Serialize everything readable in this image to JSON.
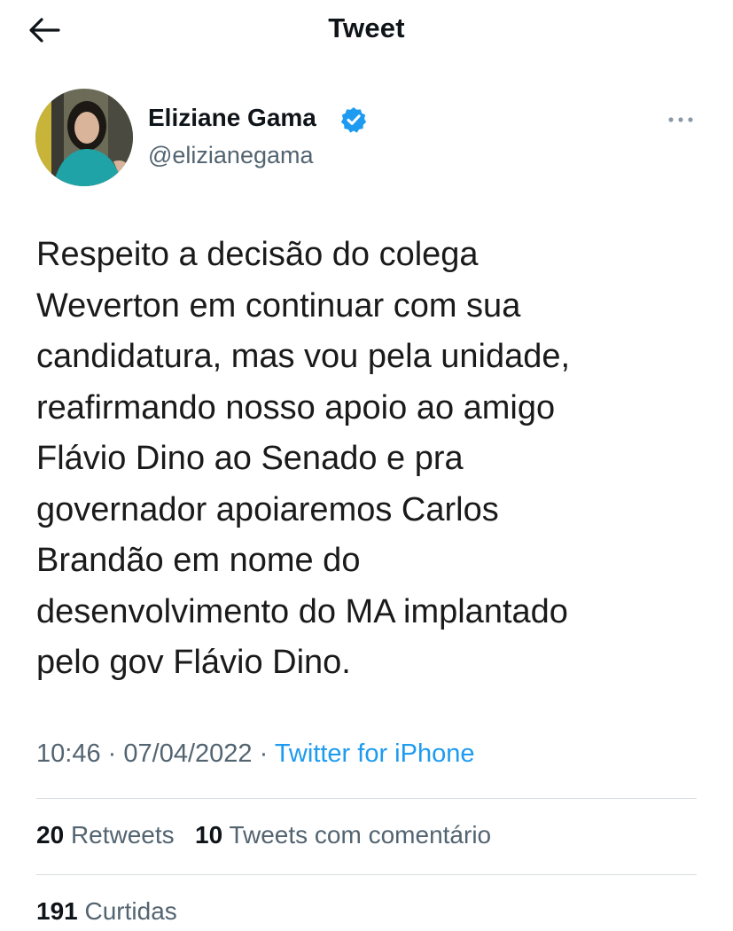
{
  "header": {
    "title": "Tweet",
    "back_icon": "arrow-left-icon"
  },
  "author": {
    "name": "Eliziane Gama",
    "handle": "@elizianegama",
    "verified_icon": "verified-badge-icon",
    "verified_color": "#1d9bf0"
  },
  "tweet": {
    "text": "Respeito a decisão do colega\nWeverton em continuar com sua\ncandidatura, mas vou pela unidade,\nreafirmando nosso apoio ao amigo\nFlávio Dino ao Senado e pra\ngovernador apoiaremos Carlos\nBrandão em nome do\ndesenvolvimento do MA implantado\npelo gov Flávio Dino.",
    "time": "10:46",
    "separator": "·",
    "date": "07/04/2022",
    "source": "Twitter for iPhone"
  },
  "stats": {
    "retweets_count": "20",
    "retweets_label": "Retweets",
    "quotes_count": "10",
    "quotes_label": "Tweets com comentário",
    "likes_count": "191",
    "likes_label": "Curtidas"
  },
  "colors": {
    "accent": "#1d9bf0",
    "secondary_text": "#536471",
    "primary_text": "#0f1419",
    "divider": "#d9dee2"
  }
}
